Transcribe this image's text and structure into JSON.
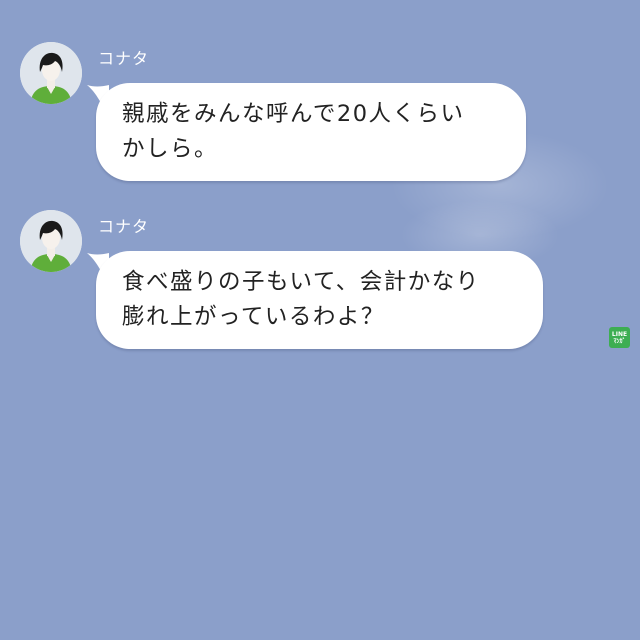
{
  "messages": [
    {
      "sender": "コナタ",
      "lines": [
        "親戚をみんな呼んで20人くらい",
        "かしら。"
      ]
    },
    {
      "sender": "コナタ",
      "lines": [
        "食べ盛りの子もいて、会計かなり",
        "膨れ上がっているわよ？"
      ]
    }
  ],
  "badge": {
    "line1": "LINE",
    "line2": "ﾏﾝｶﾞ"
  },
  "colors": {
    "background": "#8b9fca",
    "bubble": "#ffffff",
    "avatar_shirt": "#5fae3a",
    "badge": "#3dae52"
  },
  "icons": {
    "avatar": "person-avatar-icon"
  }
}
